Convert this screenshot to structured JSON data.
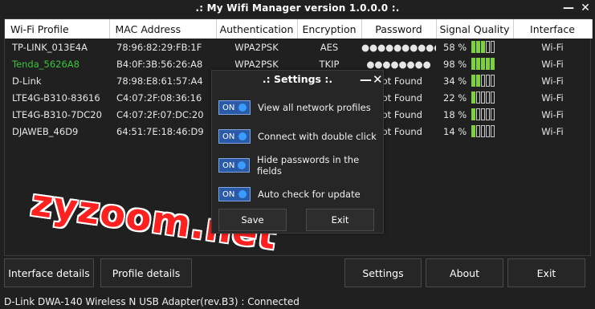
{
  "app": {
    "title": ".: My Wifi Manager version 1.0.0.0 :.",
    "minimize_glyph": "—",
    "close_glyph": "✕"
  },
  "table": {
    "columns": [
      "Wi-Fi Profile",
      "MAC Address",
      "Authentication",
      "Encryption",
      "Password",
      "Signal Quality",
      "Interface"
    ],
    "rows": [
      {
        "profile": "TP-LINK_013E4A",
        "mac": "78:96:82:29:FB:1F",
        "auth": "WPA2PSK",
        "enc": "AES",
        "password": "●●●●●●●●●●",
        "signal": "58 %",
        "signal_level": 0.58,
        "iface": "Wi-Fi",
        "connected": false
      },
      {
        "profile": "Tenda_5626A8",
        "mac": "B4:0F:3B:56:26:A8",
        "auth": "WPA2PSK",
        "enc": "TKIP",
        "password": "●●●●●●●●",
        "signal": "98 %",
        "signal_level": 0.98,
        "iface": "Wi-Fi",
        "connected": true
      },
      {
        "profile": "D-Link",
        "mac": "78:98:E8:61:57:A4",
        "auth": "",
        "enc": "",
        "password": "Not Found",
        "signal": "34 %",
        "signal_level": 0.34,
        "iface": "Wi-Fi",
        "connected": false
      },
      {
        "profile": "LTE4G-B310-83616",
        "mac": "C4:07:2F:08:36:16",
        "auth": "",
        "enc": "",
        "password": "Not Found",
        "signal": "22 %",
        "signal_level": 0.22,
        "iface": "Wi-Fi",
        "connected": false
      },
      {
        "profile": "LTE4G-B310-7DC20",
        "mac": "C4:07:2F:07:DC:20",
        "auth": "",
        "enc": "",
        "password": "Not Found",
        "signal": "18 %",
        "signal_level": 0.18,
        "iface": "Wi-Fi",
        "connected": false
      },
      {
        "profile": "DJAWEB_46D9",
        "mac": "64:51:7E:18:46:D9",
        "auth": "",
        "enc": "",
        "password": "Not Found",
        "signal": "14 %",
        "signal_level": 0.14,
        "iface": "Wi-Fi",
        "connected": false
      }
    ]
  },
  "buttons": {
    "interface_details": "Interface details",
    "profile_details": "Profile details",
    "settings": "Settings",
    "about": "About",
    "exit": "Exit"
  },
  "status": "D-Link DWA-140 Wireless N USB Adapter(rev.B3) : Connected",
  "settings_dialog": {
    "title": ".: Settings :.",
    "minimize_glyph": "—",
    "close_glyph": "✕",
    "options": [
      {
        "state": "ON",
        "label": "View all network profiles"
      },
      {
        "state": "ON",
        "label": "Connect with double click"
      },
      {
        "state": "ON",
        "label": "Hide passwords in the fields"
      },
      {
        "state": "ON",
        "label": "Auto check for update"
      }
    ],
    "save_label": "Save",
    "exit_label": "Exit"
  },
  "watermark": "zyzoom.net",
  "colors": {
    "background": "#202020",
    "connected_text": "#3cc43c",
    "signal_bar": "#7fd03a",
    "toggle": "#2a5aa8",
    "watermark": "#ff2020"
  }
}
